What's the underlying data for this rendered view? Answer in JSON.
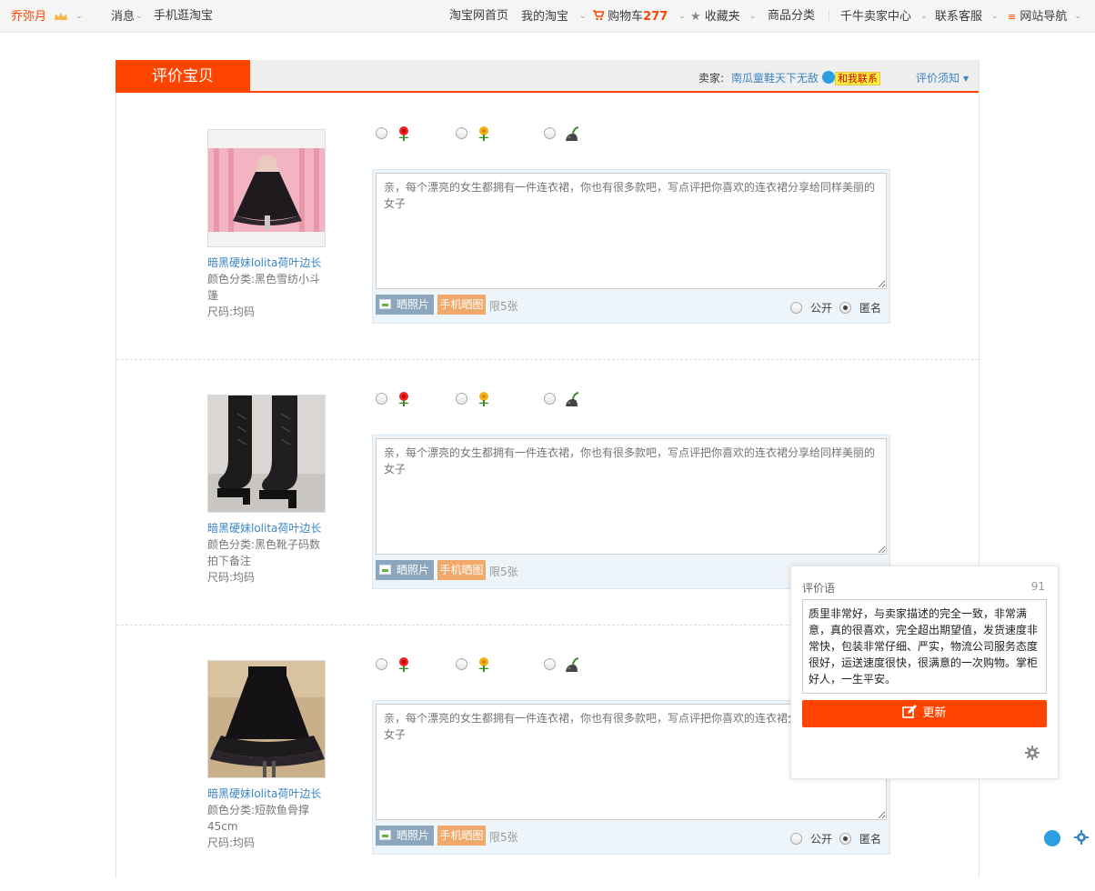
{
  "topbar": {
    "user": "乔弥月",
    "message": "消息",
    "mobile_taobao": "手机逛淘宝",
    "home": "淘宝网首页",
    "my_taobao": "我的淘宝",
    "cart_label": "购物车",
    "cart_count": "277",
    "favorites": "收藏夹",
    "categories": "商品分类",
    "seller_center": "千牛卖家中心",
    "support": "联系客服",
    "site_nav": "网站导航"
  },
  "header": {
    "title": "评价宝贝",
    "seller_label": "卖家:",
    "seller_name": "南瓜童鞋天下无敌",
    "contact": "和我联系",
    "notice": "评价须知"
  },
  "items": [
    {
      "title": "暗黑硬妹lolita荷叶边长",
      "color": "颜色分类:黑色雪纺小斗篷",
      "size": "尺码:均码",
      "placeholder": "亲，每个漂亮的女生都拥有一件连衣裙，你也有很多款吧，写点评把你喜欢的连衣裙分享给同样美丽的女子",
      "photo_btn": "晒照片",
      "mobile_btn": "手机晒图",
      "limit": "限5张",
      "public": "公开",
      "anonymous": "匿名"
    },
    {
      "title": "暗黑硬妹lolita荷叶边长",
      "color": "颜色分类:黑色靴子码数拍下备注",
      "size": "尺码:均码",
      "placeholder": "亲，每个漂亮的女生都拥有一件连衣裙，你也有很多款吧，写点评把你喜欢的连衣裙分享给同样美丽的女子",
      "photo_btn": "晒照片",
      "mobile_btn": "手机晒图",
      "limit": "限5张"
    },
    {
      "title": "暗黑硬妹lolita荷叶边长",
      "color": "颜色分类:短款鱼骨撑45cm",
      "size": "尺码:均码",
      "placeholder": "亲，每个漂亮的女生都拥有一件连衣裙，你也有很多款吧，写点评把你喜欢的连衣裙分享给同样美丽的女子",
      "photo_btn": "晒照片",
      "mobile_btn": "手机晒图",
      "limit": "限5张",
      "public": "公开",
      "anonymous": "匿名"
    }
  ],
  "panel": {
    "title": "评价语",
    "count": "91",
    "text": "质里非常好，与卖家描述的完全一致，非常满意，真的很喜欢，完全超出期望值，发货速度非常快，包装非常仔细、严实，物流公司服务态度很好，运送速度很快，很满意的一次购物。掌柜好人，一生平安。",
    "button": "更新"
  },
  "colors": {
    "accent": "#ff4400",
    "link": "#3c85c5"
  }
}
